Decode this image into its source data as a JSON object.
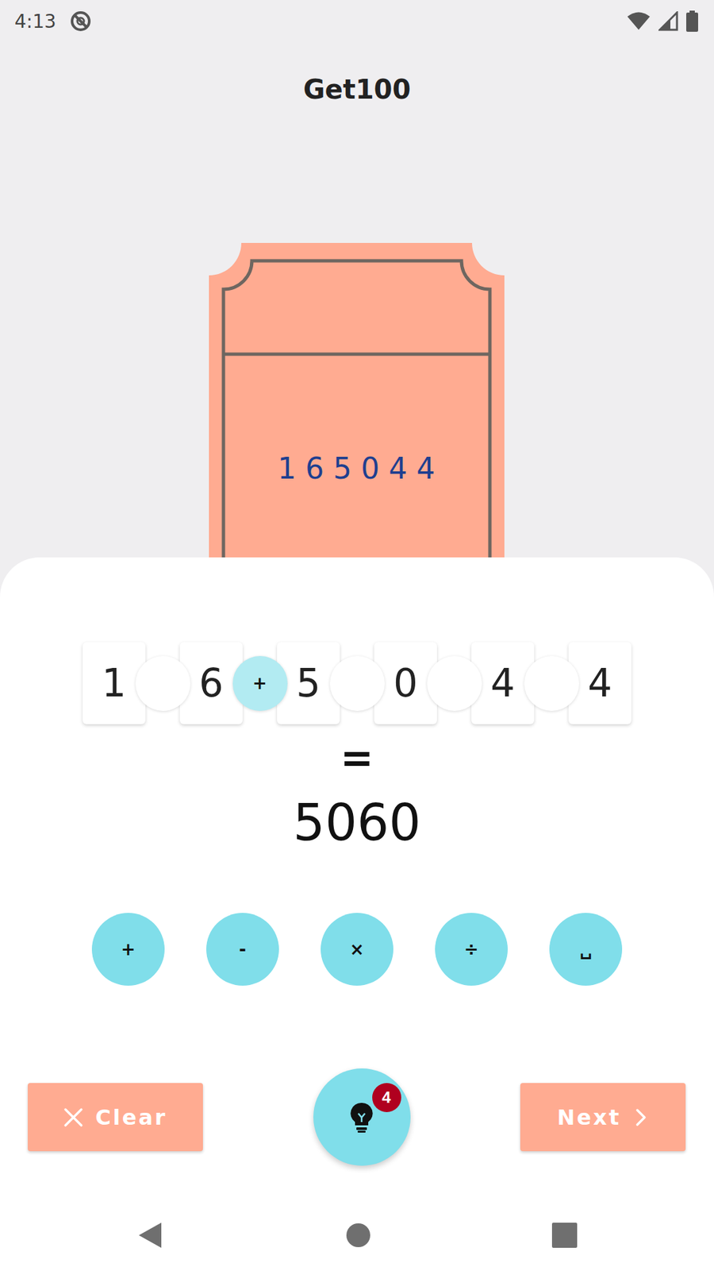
{
  "status_bar": {
    "time": "4:13"
  },
  "app_bar": {
    "title": "Get100"
  },
  "ticket": {
    "number": "1 6 5 0 4 4"
  },
  "puzzle": {
    "digits": [
      "1",
      "6",
      "5",
      "0",
      "4",
      "4"
    ],
    "slots": [
      {
        "operator": "",
        "filled": false
      },
      {
        "operator": "+",
        "filled": true
      },
      {
        "operator": "",
        "filled": false
      },
      {
        "operator": "",
        "filled": false
      },
      {
        "operator": "",
        "filled": false
      }
    ],
    "equals": "=",
    "result": "5060"
  },
  "operators": [
    "+",
    "-",
    "×",
    "÷",
    "␣"
  ],
  "buttons": {
    "clear": "Clear",
    "next": "Next"
  },
  "hint": {
    "badge": "4"
  }
}
